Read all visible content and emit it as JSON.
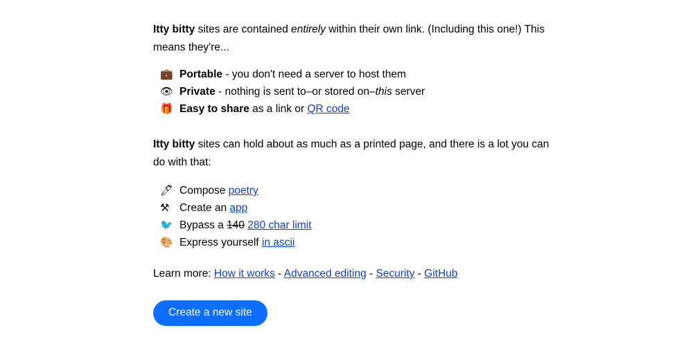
{
  "colors": {
    "background": "#ffffff",
    "text": "#000000",
    "link": "#0b41cd",
    "button_bg": "#0d6efd",
    "button_text": "#ffffff"
  },
  "intro": {
    "brand": "Itty bitty",
    "text_1": " sites are contained ",
    "emphasis": "entirely",
    "text_2": " within their own link. (Including this one!) This means they're..."
  },
  "features": [
    {
      "icon": "briefcase-icon",
      "glyph": "💼",
      "title": "Portable",
      "rest": " - you don't need a server to host them"
    },
    {
      "icon": "eye-icon",
      "glyph": "👁",
      "title": "Private",
      "rest_a": " - nothing is sent to–or stored on–",
      "emphasis": "this",
      "rest_b": " server"
    },
    {
      "icon": "gift-icon",
      "glyph": "🎁",
      "title": "Easy to share",
      "rest_a": " as a link or ",
      "link_label": "QR code"
    }
  ],
  "capacity": {
    "brand": "Itty bitty",
    "text": " sites can hold about as much as a printed page, and there is a lot you can do with that:"
  },
  "uses": [
    {
      "icon": "pen-nib-icon",
      "glyph": "🖊",
      "prefix": "Compose ",
      "link_label": "poetry"
    },
    {
      "icon": "hammer-and-pick-icon",
      "glyph": "⚒",
      "prefix": "Create an ",
      "link_label": "app"
    },
    {
      "icon": "bird-icon",
      "glyph": "🐦",
      "prefix": "Bypass a ",
      "struck": "140",
      "link_label": "280 char limit"
    },
    {
      "icon": "artist-palette-icon",
      "glyph": "🎨",
      "prefix": "Express yourself ",
      "link_label": "in ascii"
    }
  ],
  "learn_more": {
    "label": "Learn more:",
    "separator": "-",
    "links": [
      "How it works",
      "Advanced editing",
      "Security",
      "GitHub"
    ]
  },
  "cta": {
    "label": "Create a new site"
  }
}
